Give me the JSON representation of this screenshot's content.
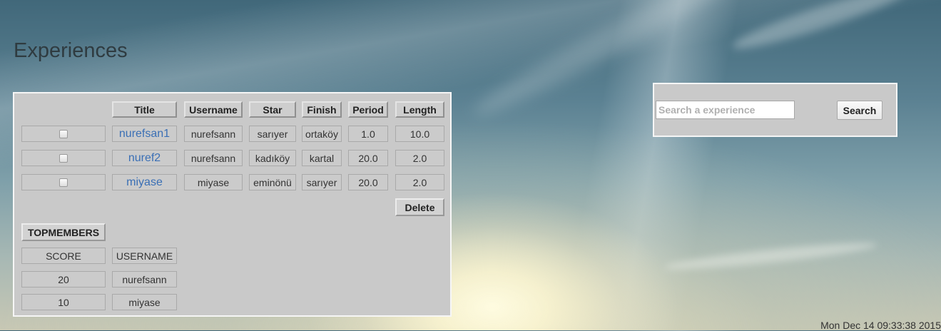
{
  "page": {
    "title": "Experiences"
  },
  "experiences_table": {
    "headers": [
      "Title",
      "Username",
      "Star",
      "Finish",
      "Period",
      "Length"
    ],
    "rows": [
      {
        "title": "nurefsan1",
        "username": "nurefsann",
        "star": "sarıyer",
        "finish": "ortaköy",
        "period": "1.0",
        "length": "10.0",
        "checked": false
      },
      {
        "title": "nuref2",
        "username": "nurefsann",
        "star": "kadıköy",
        "finish": "kartal",
        "period": "20.0",
        "length": "2.0",
        "checked": false
      },
      {
        "title": "miyase",
        "username": "miyase",
        "star": "eminönü",
        "finish": "sarıyer",
        "period": "20.0",
        "length": "2.0",
        "checked": false
      }
    ],
    "delete_label": "Delete"
  },
  "top_members": {
    "button_label": "TOPMEMBERS",
    "headers": [
      "SCORE",
      "USERNAME"
    ],
    "rows": [
      {
        "score": "20",
        "username": "nurefsann"
      },
      {
        "score": "10",
        "username": "miyase"
      }
    ]
  },
  "search": {
    "placeholder": "Search a experience",
    "value": "",
    "button_label": "Search"
  },
  "status": {
    "clock": "Mon Dec 14 09:33:38 2015"
  },
  "colors": {
    "panel_bg": "#c9c9c9",
    "link": "#3a6fb5",
    "panel_border": "#f6f6f6"
  }
}
